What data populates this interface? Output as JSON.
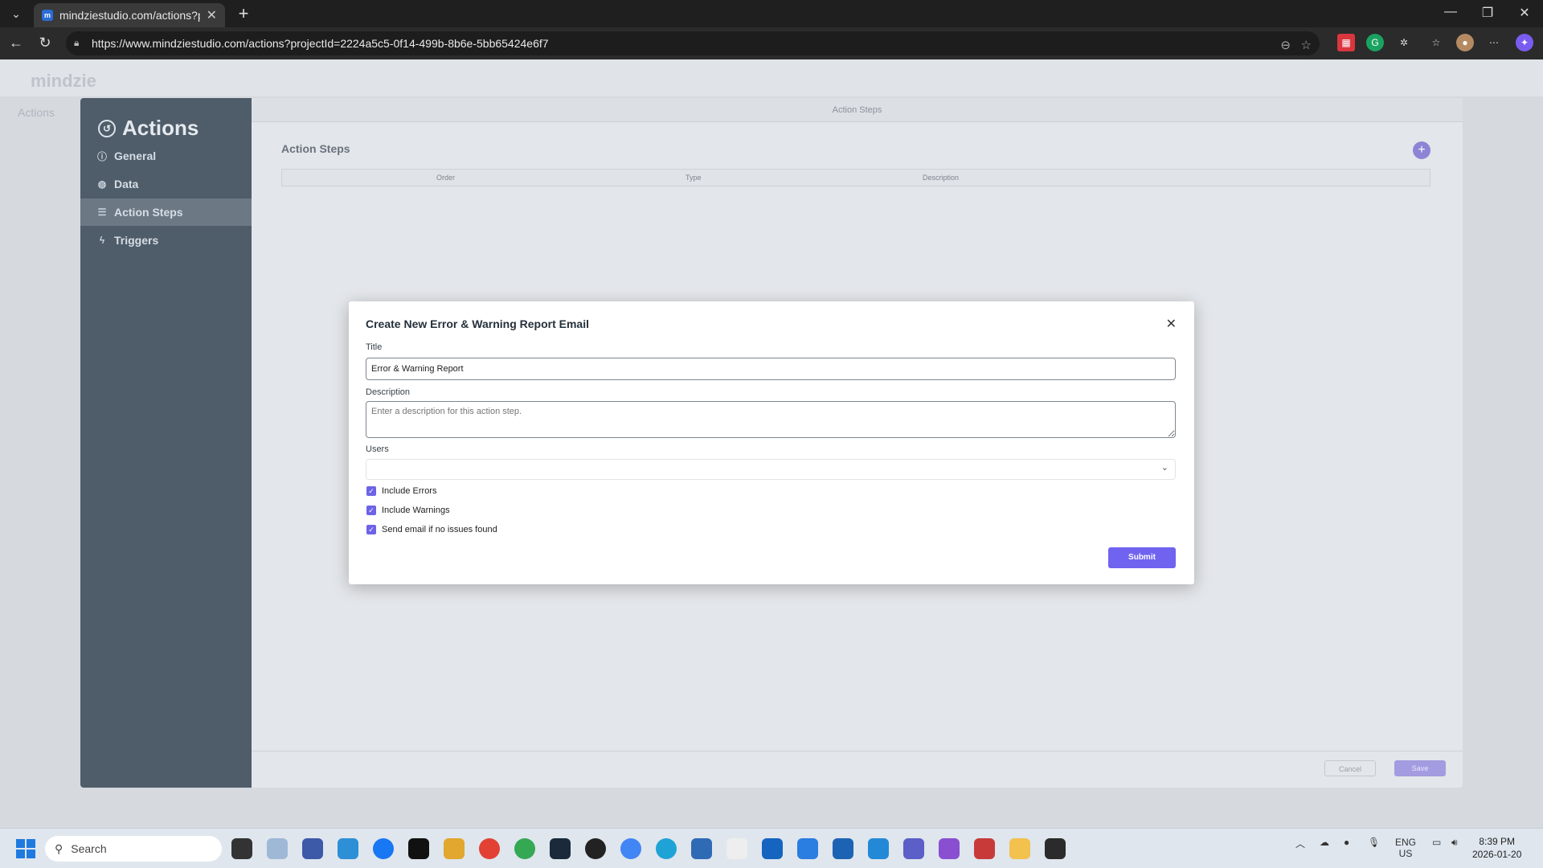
{
  "browser": {
    "tab_title": "mindziestudio.com/actions?proje",
    "url": "https://www.mindziestudio.com/actions?projectId=2224a5c5-0f14-499b-8b6e-5bb65424e6f7"
  },
  "background": {
    "brand": "mindzie",
    "left_title": "Actions"
  },
  "side_panel": {
    "title": "Actions",
    "items": [
      {
        "label": "General",
        "icon": "info-icon"
      },
      {
        "label": "Data",
        "icon": "database-icon"
      },
      {
        "label": "Action Steps",
        "icon": "list-icon"
      },
      {
        "label": "Triggers",
        "icon": "bolt-icon"
      }
    ]
  },
  "content": {
    "header": "Action Steps",
    "section_title": "Action Steps",
    "columns": [
      "Order",
      "Type",
      "Description"
    ],
    "footer_cancel": "Cancel",
    "footer_save": "Save"
  },
  "dialog": {
    "title": "Create New Error & Warning Report Email",
    "title_label": "Title",
    "title_value": "Error & Warning Report",
    "description_label": "Description",
    "description_placeholder": "Enter a description for this action step.",
    "users_label": "Users",
    "users_value": "",
    "checkboxes": [
      {
        "label": "Include Errors",
        "checked": true
      },
      {
        "label": "Include Warnings",
        "checked": true
      },
      {
        "label": "Send email if no issues found",
        "checked": true
      }
    ],
    "submit_label": "Submit"
  },
  "taskbar": {
    "search_placeholder": "Search",
    "lang": "ENG",
    "region": "US",
    "time": "8:39 PM",
    "date": "2026-01-20"
  },
  "colors": {
    "accent": "#6f63f0",
    "sidebar": "#4f5d6a"
  }
}
